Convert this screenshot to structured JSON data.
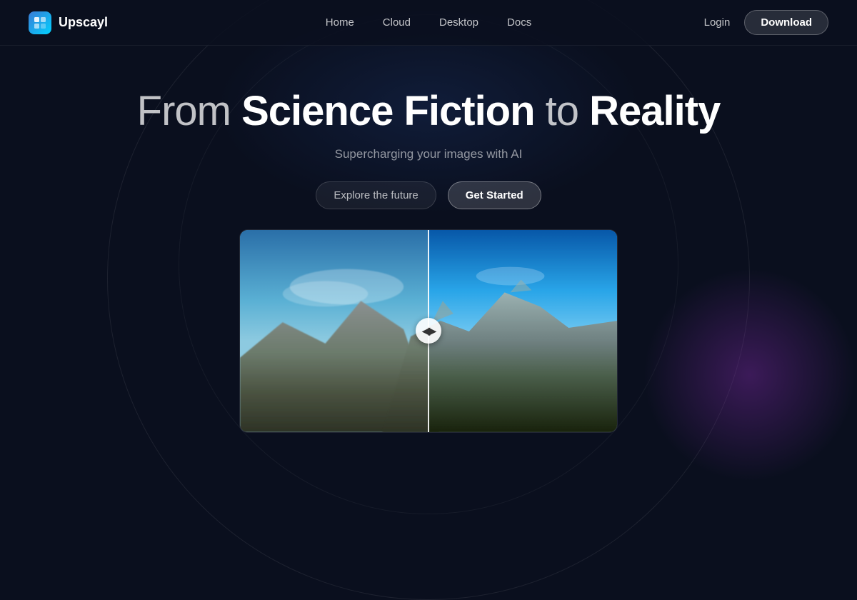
{
  "brand": {
    "name": "Upscayl",
    "logo_alt": "Upscayl logo"
  },
  "nav": {
    "links": [
      {
        "id": "home",
        "label": "Home"
      },
      {
        "id": "cloud",
        "label": "Cloud"
      },
      {
        "id": "desktop",
        "label": "Desktop"
      },
      {
        "id": "docs",
        "label": "Docs"
      }
    ],
    "login_label": "Login",
    "download_label": "Download"
  },
  "hero": {
    "title_part1": "From ",
    "title_bold1": "Science Fiction",
    "title_part2": " to ",
    "title_bold2": "Reality",
    "subtitle": "Supercharging your images with  AI",
    "cta_explore": "Explore the future",
    "cta_start": "Get Started"
  },
  "comparison": {
    "handle_icon": "◀▶"
  },
  "colors": {
    "bg": "#0a0f1e",
    "accent_blue": "#3a7bd5",
    "accent_purple": "#7828a0"
  }
}
